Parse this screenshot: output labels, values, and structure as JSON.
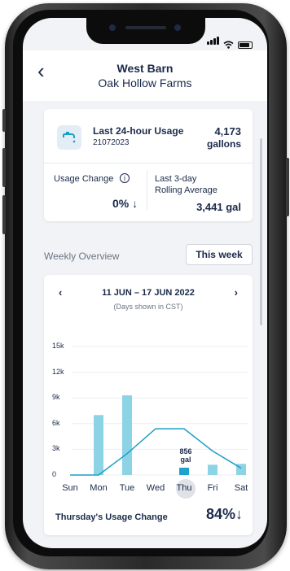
{
  "header": {
    "back_icon": "chevron-left-icon",
    "title": "West Barn",
    "subtitle": "Oak Hollow Farms"
  },
  "usage_card": {
    "icon": "faucet-icon",
    "title": "Last 24-hour Usage",
    "date": "21072023",
    "value": "4,173",
    "unit": "gallons",
    "usage_change_label": "Usage Change",
    "info_icon": "info-icon",
    "usage_change_value": "0%",
    "down_arrow": "↓",
    "rolling_label_1": "Last 3-day",
    "rolling_label_2": "Rolling Average",
    "rolling_value": "3,441 gal"
  },
  "weekly": {
    "section_label": "Weekly Overview",
    "period_button": "This week",
    "prev_icon": "‹",
    "next_icon": "›",
    "range": "11 JUN – 17 JUN 2022",
    "note": "(Days shown in CST)",
    "footer_label": "Thursday's Usage Change",
    "footer_value": "84%",
    "footer_arrow": "↓"
  },
  "chart_data": {
    "type": "bar",
    "categories": [
      "Sun",
      "Mon",
      "Tue",
      "Wed",
      "Thu",
      "Fri",
      "Sat"
    ],
    "series": [
      {
        "values": [
          0,
          7000,
          9300,
          0,
          856,
          1200,
          1300
        ]
      },
      {
        "type": "line",
        "values": [
          0,
          0,
          2500,
          5400,
          5400,
          2800,
          800
        ]
      }
    ],
    "yticks": [
      "15k",
      "12k",
      "9k",
      "6k",
      "3k",
      "0"
    ],
    "ylim": [
      0,
      15000
    ],
    "annotation": {
      "category": "Thu",
      "line1": "856",
      "line2": "gal"
    },
    "colors": {
      "bar": "#8dd3e6",
      "highlight_bar": "#1ea3cf",
      "line": "#1c9ec4"
    }
  }
}
